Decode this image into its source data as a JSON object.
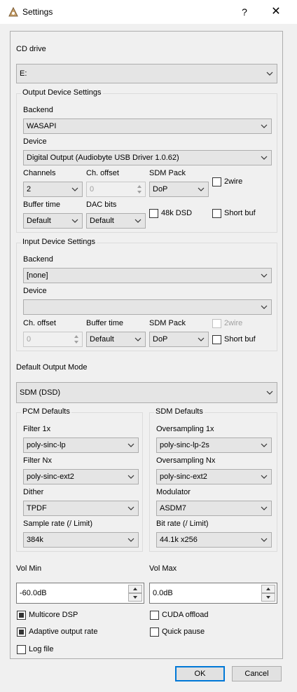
{
  "window": {
    "title": "Settings",
    "help_label": "?",
    "close_label": "✕"
  },
  "cd_drive": {
    "label": "CD drive",
    "value": "E:"
  },
  "output_device": {
    "title": "Output Device Settings",
    "backend_label": "Backend",
    "backend_value": "WASAPI",
    "device_label": "Device",
    "device_value": "Digital Output (Audiobyte USB Driver 1.0.62)",
    "channels_label": "Channels",
    "channels_value": "2",
    "ch_offset_label": "Ch. offset",
    "ch_offset_value": "0",
    "sdm_pack_label": "SDM Pack",
    "sdm_pack_value": "DoP",
    "twowire_label": "2wire",
    "buffer_time_label": "Buffer time",
    "buffer_time_value": "Default",
    "dac_bits_label": "DAC bits",
    "dac_bits_value": "Default",
    "dsd48k_label": "48k DSD",
    "short_buf_label": "Short buf"
  },
  "input_device": {
    "title": "Input Device Settings",
    "backend_label": "Backend",
    "backend_value": "[none]",
    "device_label": "Device",
    "device_value": "",
    "ch_offset_label": "Ch. offset",
    "ch_offset_value": "0",
    "buffer_time_label": "Buffer time",
    "buffer_time_value": "Default",
    "sdm_pack_label": "SDM Pack",
    "sdm_pack_value": "DoP",
    "twowire_label": "2wire",
    "short_buf_label": "Short buf"
  },
  "default_output_mode": {
    "label": "Default Output Mode",
    "value": "SDM (DSD)"
  },
  "pcm_defaults": {
    "title": "PCM Defaults",
    "filter1x_label": "Filter 1x",
    "filter1x_value": "poly-sinc-lp",
    "filternx_label": "Filter Nx",
    "filternx_value": "poly-sinc-ext2",
    "dither_label": "Dither",
    "dither_value": "TPDF",
    "sample_rate_label": "Sample rate (/ Limit)",
    "sample_rate_value": "384k"
  },
  "sdm_defaults": {
    "title": "SDM Defaults",
    "os1x_label": "Oversampling 1x",
    "os1x_value": "poly-sinc-lp-2s",
    "osnx_label": "Oversampling Nx",
    "osnx_value": "poly-sinc-ext2",
    "modulator_label": "Modulator",
    "modulator_value": "ASDM7",
    "bit_rate_label": "Bit rate (/ Limit)",
    "bit_rate_value": "44.1k x256"
  },
  "volume": {
    "min_label": "Vol Min",
    "min_value": "-60.0dB",
    "max_label": "Vol Max",
    "max_value": "0.0dB"
  },
  "options": {
    "multicore_label": "Multicore DSP",
    "cuda_label": "CUDA offload",
    "adaptive_label": "Adaptive output rate",
    "quick_pause_label": "Quick pause",
    "log_file_label": "Log file"
  },
  "buttons": {
    "ok_label": "OK",
    "cancel_label": "Cancel"
  }
}
